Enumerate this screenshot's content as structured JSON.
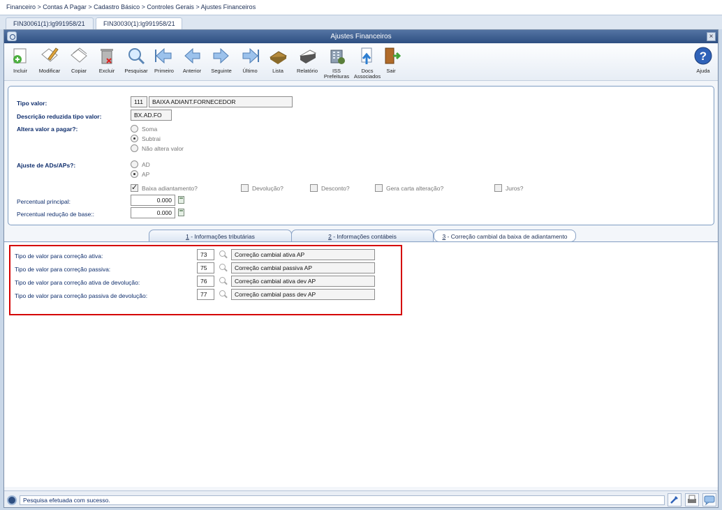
{
  "breadcrumb": "Financeiro > Contas A Pagar > Cadastro Básico > Controles Gerais > Ajustes Financeiros",
  "doc_tabs": [
    "FIN30061(1):lg991958/21",
    "FIN30030(1):lg991958/21"
  ],
  "window": {
    "title": "Ajustes Financeiros",
    "close": "×"
  },
  "toolbar": {
    "incluir": "Incluir",
    "modificar": "Modificar",
    "copiar": "Copiar",
    "excluir": "Excluir",
    "pesquisar": "Pesquisar",
    "primeiro": "Primeiro",
    "anterior": "Anterior",
    "seguinte": "Seguinte",
    "ultimo": "Último",
    "lista": "Lista",
    "relatorio": "Relatório",
    "iss": "ISS Prefeituras",
    "docs": "Docs Associados",
    "sair": "Sair",
    "ajuda": "Ajuda"
  },
  "form": {
    "tipo_valor_label": "Tipo valor:",
    "tipo_valor_code": "111",
    "tipo_valor_desc": "BAIXA ADIANT.FORNECEDOR",
    "desc_reduzida_label": "Descrição reduzida tipo valor:",
    "desc_reduzida_value": "BX.AD.FO",
    "altera_label": "Altera valor a pagar?:",
    "altera_options": [
      "Soma",
      "Subtrai",
      "Não altera valor"
    ],
    "altera_selected": "Subtrai",
    "ajuste_label": "Ajuste de ADs/APs?:",
    "ajuste_options": [
      "AD",
      "AP"
    ],
    "ajuste_selected": "AP",
    "checkboxes": {
      "baixa": "Baixa adiantamento?",
      "devolucao": "Devolução?",
      "desconto": "Desconto?",
      "gera_carta": "Gera carta alteração?",
      "juros": "Juros?"
    },
    "checked": [
      "Baixa adiantamento?"
    ],
    "percentual_principal_label": "Percentual principal:",
    "percentual_principal_value": "0.000",
    "percentual_reducao_label": "Percentual redução de base::",
    "percentual_reducao_value": "0.000"
  },
  "subtabs": [
    {
      "num": "1",
      "label": " - Informações tributárias"
    },
    {
      "num": "2",
      "label": " - Informações contábeis"
    },
    {
      "num": "3",
      "label": " - Correção cambial da baixa de adiantamento"
    }
  ],
  "active_subtab": "3",
  "correcao": [
    {
      "label": "Tipo de valor para correção ativa:",
      "code": "73",
      "desc": "Correção cambial ativa AP"
    },
    {
      "label": "Tipo de valor para correção passiva:",
      "code": "75",
      "desc": "Correção cambial passiva AP"
    },
    {
      "label": "Tipo de valor para correção ativa de devolução:",
      "code": "76",
      "desc": "Correção cambial ativa dev AP"
    },
    {
      "label": "Tipo de valor para correção passiva de devolução:",
      "code": "77",
      "desc": "Correção cambial pass dev AP"
    }
  ],
  "status": "Pesquisa efetuada com sucesso.",
  "colors": {
    "highlight_border": "#d40000",
    "titlebar": "#2e4f82",
    "label_blue": "#0f2e6d"
  }
}
